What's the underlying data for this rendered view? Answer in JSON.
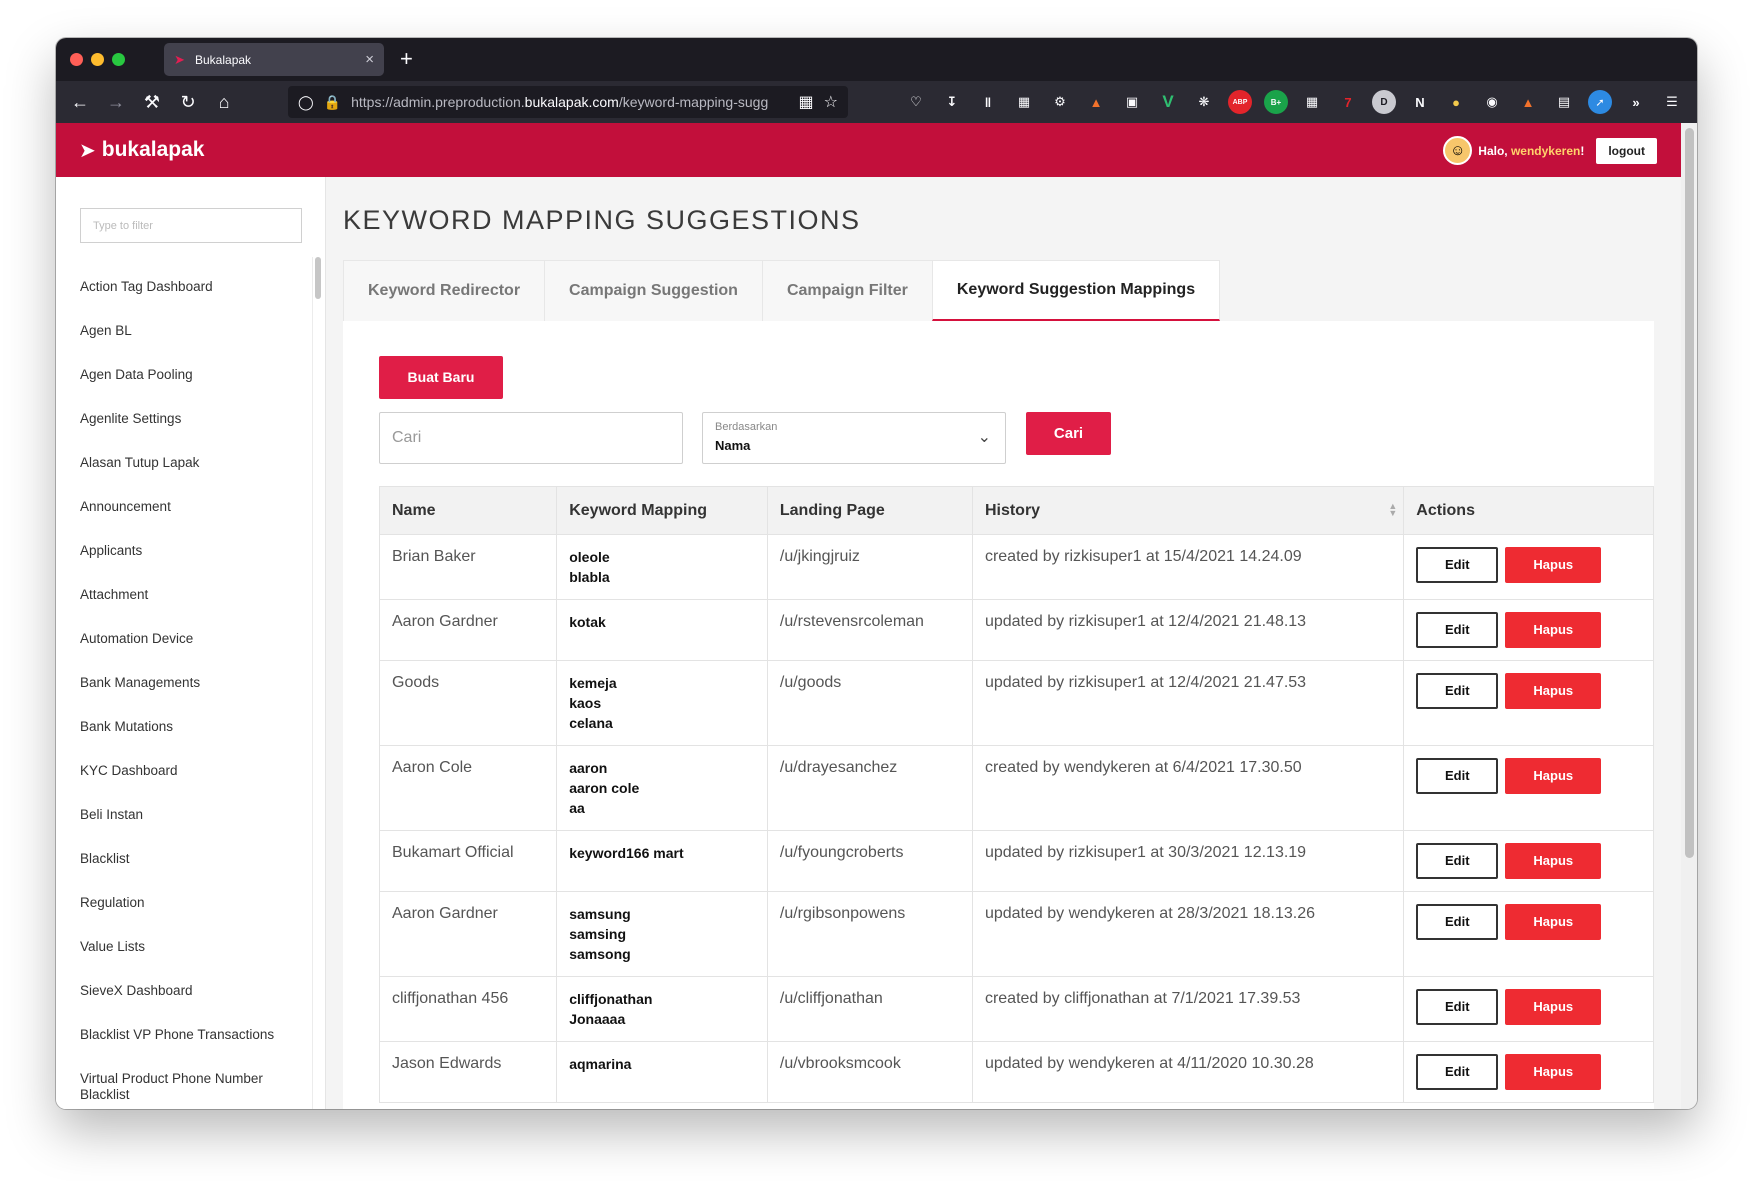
{
  "browser": {
    "tab_title": "Bukalapak",
    "url_prefix": "https://admin.preproduction.",
    "url_domain": "bukalapak.com",
    "url_suffix": "/keyword-mapping-sugg",
    "ext_badge": "7"
  },
  "header": {
    "brand": "bukalapak",
    "greeting": "Halo, ",
    "username": "wendykeren",
    "greeting_end": "!",
    "logout": "logout"
  },
  "sidebar": {
    "filter_placeholder": "Type to filter",
    "items": [
      "Action Tag Dashboard",
      "Agen BL",
      "Agen Data Pooling",
      "Agenlite Settings",
      "Alasan Tutup Lapak",
      "Announcement",
      "Applicants",
      "Attachment",
      "Automation Device",
      "Bank Managements",
      "Bank Mutations",
      "KYC Dashboard",
      "Beli Instan",
      "Blacklist",
      "Regulation",
      "Value Lists",
      "SieveX Dashboard",
      "Blacklist VP Phone Transactions",
      "Virtual Product Phone Number Blacklist"
    ]
  },
  "main": {
    "title": "KEYWORD MAPPING SUGGESTIONS",
    "tabs": [
      "Keyword Redirector",
      "Campaign Suggestion",
      "Campaign Filter",
      "Keyword Suggestion Mappings"
    ],
    "active_tab": "Keyword Suggestion Mappings",
    "create_button": "Buat Baru",
    "search_placeholder": "Cari",
    "select_label": "Berdasarkan",
    "select_value": "Nama",
    "search_button": "Cari"
  },
  "table": {
    "headers": [
      "Name",
      "Keyword Mapping",
      "Landing Page",
      "History",
      "Actions"
    ],
    "edit_label": "Edit",
    "delete_label": "Hapus",
    "rows": [
      {
        "name": "Brian Baker",
        "keywords": [
          "oleole",
          "blabla"
        ],
        "landing": "/u/jkingjruiz",
        "history": "created by rizkisuper1 at 15/4/2021 14.24.09"
      },
      {
        "name": "Aaron Gardner",
        "keywords": [
          "kotak"
        ],
        "landing": "/u/rstevensrcoleman",
        "history": "updated by rizkisuper1 at 12/4/2021 21.48.13"
      },
      {
        "name": "Goods",
        "keywords": [
          "kemeja",
          "kaos",
          "celana"
        ],
        "landing": "/u/goods",
        "history": "updated by rizkisuper1 at 12/4/2021 21.47.53"
      },
      {
        "name": "Aaron Cole",
        "keywords": [
          "aaron",
          "aaron cole",
          "aa"
        ],
        "landing": "/u/drayesanchez",
        "history": "created by wendykeren at 6/4/2021 17.30.50"
      },
      {
        "name": "Bukamart Official",
        "keywords": [
          "keyword166 mart"
        ],
        "landing": "/u/fyoungcroberts",
        "history": "updated by rizkisuper1 at 30/3/2021 12.13.19"
      },
      {
        "name": "Aaron Gardner",
        "keywords": [
          "samsung",
          "samsing",
          "samsong"
        ],
        "landing": "/u/rgibsonpowens",
        "history": "updated by wendykeren at 28/3/2021 18.13.26"
      },
      {
        "name": "cliffjonathan 456",
        "keywords": [
          "cliffjonathan",
          "Jonaaaa"
        ],
        "landing": "/u/cliffjonathan",
        "history": "created by cliffjonathan at 7/1/2021 17.39.53"
      },
      {
        "name": "Jason Edwards",
        "keywords": [
          "aqmarina"
        ],
        "landing": "/u/vbrooksmcook",
        "history": "updated by wendykeren at 4/11/2020 10.30.28"
      }
    ]
  }
}
